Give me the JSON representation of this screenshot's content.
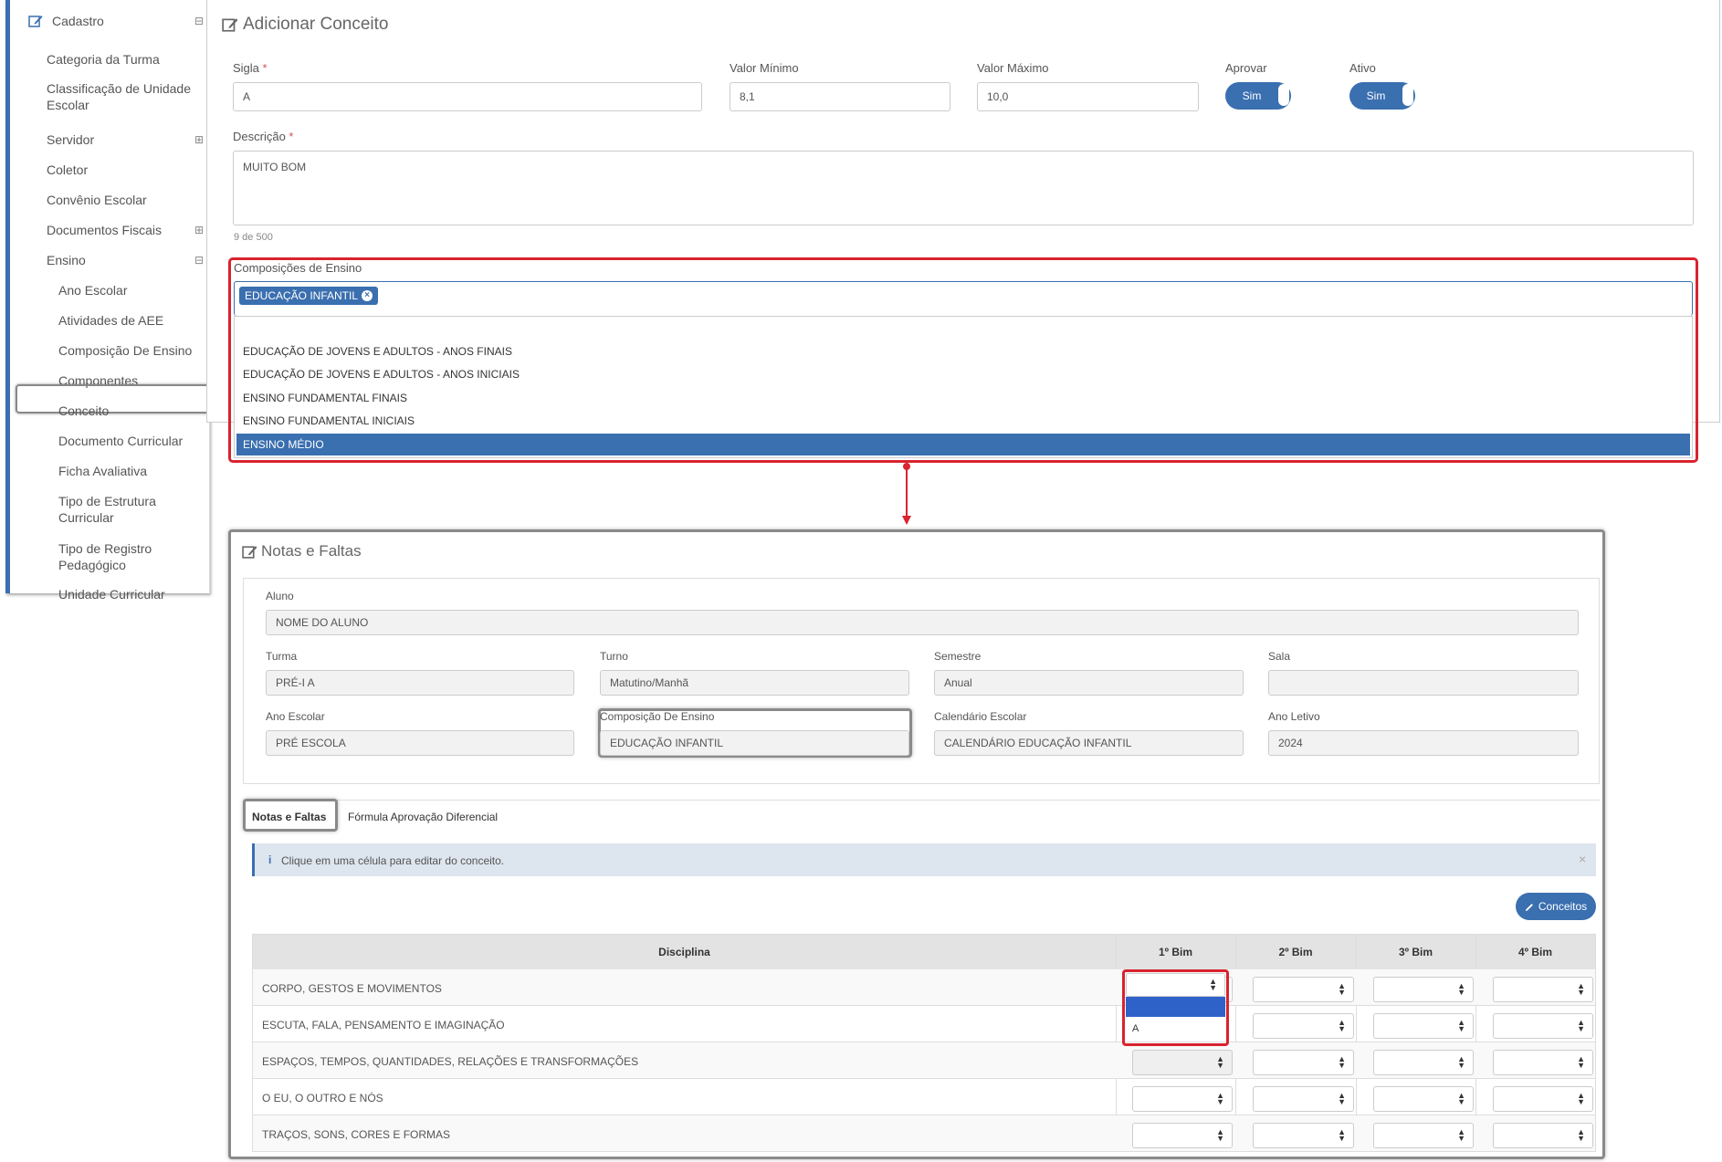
{
  "sidebar": {
    "header": "Cadastro",
    "items": [
      {
        "label": "Categoria da Turma",
        "expandable": false
      },
      {
        "label": "Classificação de Unidade Escolar",
        "expandable": false
      },
      {
        "label": "Servidor",
        "expandable": true
      },
      {
        "label": "Coletor",
        "expandable": false
      },
      {
        "label": "Convênio Escolar",
        "expandable": false
      },
      {
        "label": "Documentos Fiscais",
        "expandable": true
      },
      {
        "label": "Ensino",
        "expandable": true
      }
    ],
    "subitems": [
      "Ano Escolar",
      "Atividades de AEE",
      "Composição De Ensino",
      "Componentes",
      "Conceito",
      "Documento Curricular",
      "Ficha Avaliativa",
      "Tipo de Estrutura Curricular",
      "Tipo de Registro Pedagógico",
      "Unidade Curricular"
    ],
    "selected": "Conceito",
    "expand_symbol": "⊟",
    "collapsed_symbol": "⊞"
  },
  "form": {
    "title": "Adicionar Conceito",
    "sigla_label": "Sigla",
    "sigla_value": "A",
    "valor_min_label": "Valor Mínimo",
    "valor_min_value": "8,1",
    "valor_max_label": "Valor Máximo",
    "valor_max_value": "10,0",
    "aprovar_label": "Aprovar",
    "aprovar_value": "Sim",
    "ativo_label": "Ativo",
    "ativo_value": "Sim",
    "descricao_label": "Descrição",
    "descricao_value": "MUITO BOM",
    "char_count": "9 de 500",
    "required_mark": "*",
    "composicoes_label": "Composições de Ensino",
    "selected_tag": "EDUCAÇÃO INFANTIL",
    "dropdown_options": [
      "EDUCAÇÃO DE JOVENS E ADULTOS - ANOS FINAIS",
      "EDUCAÇÃO DE JOVENS E ADULTOS - ANOS INICIAIS",
      "ENSINO FUNDAMENTAL FINAIS",
      "ENSINO FUNDAMENTAL INICIAIS",
      "ENSINO MÉDIO"
    ],
    "highlighted_option": "ENSINO MÉDIO"
  },
  "notas": {
    "title": "Notas e Faltas",
    "aluno_label": "Aluno",
    "aluno_value": "NOME DO ALUNO",
    "turma_label": "Turma",
    "turma_value": "PRÉ-I A",
    "turno_label": "Turno",
    "turno_value": "Matutino/Manhã",
    "semestre_label": "Semestre",
    "semestre_value": "Anual",
    "sala_label": "Sala",
    "sala_value": "",
    "ano_escolar_label": "Ano Escolar",
    "ano_escolar_value": "PRÉ ESCOLA",
    "composicao_label": "Composição De Ensino",
    "composicao_value": "EDUCAÇÃO INFANTIL",
    "calendario_label": "Calendário Escolar",
    "calendario_value": "CALENDÁRIO EDUCAÇÃO INFANTIL",
    "ano_letivo_label": "Ano Letivo",
    "ano_letivo_value": "2024",
    "tabs": [
      "Notas e Faltas",
      "Fórmula Aprovação Diferencial"
    ],
    "info_text": "Clique em uma célula para editar do conceito.",
    "info_icon": "i",
    "close_symbol": "×",
    "conceitos_button": "Conceitos",
    "columns": [
      "Disciplina",
      "1º Bim",
      "2º Bim",
      "3º Bim",
      "4º Bim"
    ],
    "disciplinas": [
      "CORPO, GESTOS E MOVIMENTOS",
      "ESCUTA, FALA, PENSAMENTO E IMAGINAÇÃO",
      "ESPAÇOS, TEMPOS, QUANTIDADES, RELAÇÕES E TRANSFORMAÇÕES",
      "O EU, O OUTRO E NÓS",
      "TRAÇOS, SONS, CORES E FORMAS"
    ],
    "dropdown_option": "A"
  },
  "colors": {
    "accent": "#3a6fb0",
    "highlight_red": "#d9232e"
  }
}
